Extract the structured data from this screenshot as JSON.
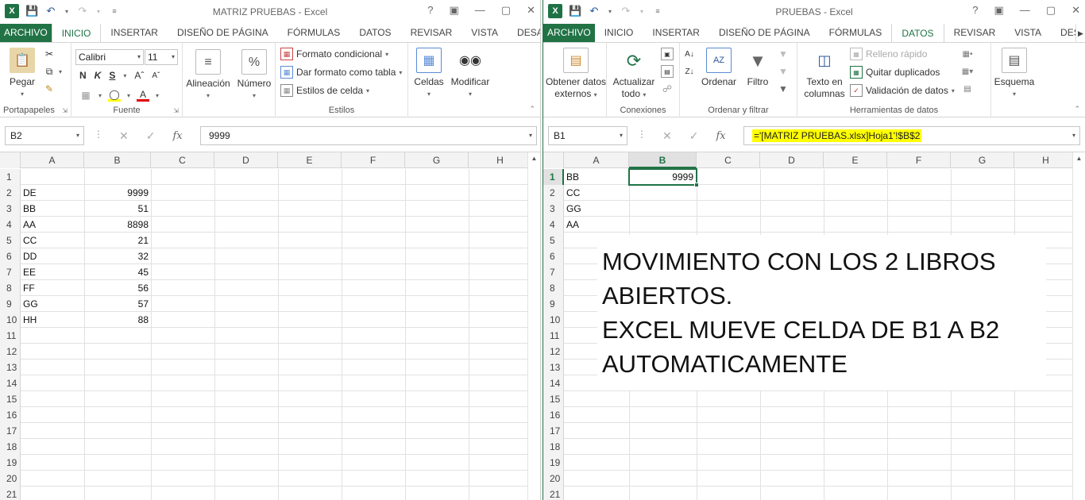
{
  "left_window": {
    "title": "MATRIZ PRUEBAS - Excel",
    "tabs": [
      "ARCHIVO",
      "INICIO",
      "INSERTAR",
      "DISEÑO DE PÁGINA",
      "FÓRMULAS",
      "DATOS",
      "REVISAR",
      "VISTA",
      "DESAR"
    ],
    "active_tab": "INICIO",
    "ribbon": {
      "paste_label": "Pegar",
      "clipboard_group": "Portapapeles",
      "font_name": "Calibri",
      "font_size": "11",
      "font_group": "Fuente",
      "bold": "N",
      "italic": "K",
      "underline": "S",
      "alignment_label": "Alineación",
      "number_label": "Número",
      "conditional_format": "Formato condicional",
      "format_as_table": "Dar formato como tabla",
      "cell_styles": "Estilos de celda",
      "styles_group": "Estilos",
      "cells_label": "Celdas",
      "modify_label": "Modificar"
    },
    "name_box": "B2",
    "formula": "9999",
    "columns": [
      "A",
      "B",
      "C",
      "D",
      "E",
      "F",
      "G",
      "H"
    ],
    "rows": [
      "1",
      "2",
      "3",
      "4",
      "5",
      "6",
      "7",
      "8",
      "9",
      "10",
      "11",
      "12",
      "13",
      "14",
      "15",
      "16",
      "17",
      "18",
      "19",
      "20",
      "21"
    ],
    "cells_a": [
      "",
      "DE",
      "BB",
      "AA",
      "CC",
      "DD",
      "EE",
      "FF",
      "GG",
      "HH"
    ],
    "cells_b": [
      "",
      "9999",
      "51",
      "8898",
      "21",
      "32",
      "45",
      "56",
      "57",
      "88"
    ]
  },
  "right_window": {
    "title": "PRUEBAS - Excel",
    "tabs": [
      "ARCHIVO",
      "INICIO",
      "INSERTAR",
      "DISEÑO DE PÁGINA",
      "FÓRMULAS",
      "DATOS",
      "REVISAR",
      "VISTA",
      "DESAR"
    ],
    "active_tab": "DATOS",
    "ribbon": {
      "get_external_1": "Obtener datos",
      "get_external_2": "externos",
      "refresh_1": "Actualizar",
      "refresh_2": "todo",
      "connections_group": "Conexiones",
      "sort_label": "Ordenar",
      "filter_label": "Filtro",
      "sort_filter_group": "Ordenar y filtrar",
      "text_to_columns_1": "Texto en",
      "text_to_columns_2": "columnas",
      "flash_fill": "Relleno rápido",
      "remove_duplicates": "Quitar duplicados",
      "data_validation": "Validación de datos",
      "data_tools_group": "Herramientas de datos",
      "outline_label": "Esquema"
    },
    "name_box": "B1",
    "formula": "='[MATRIZ PRUEBAS.xlsx]Hoja1'!$B$2",
    "columns": [
      "A",
      "B",
      "C",
      "D",
      "E",
      "F",
      "G",
      "H"
    ],
    "rows": [
      "1",
      "2",
      "3",
      "4",
      "5",
      "6",
      "7",
      "8",
      "9",
      "10",
      "11",
      "12",
      "13",
      "14",
      "15",
      "16",
      "17",
      "18",
      "19",
      "20",
      "21"
    ],
    "cells_a": [
      "BB",
      "CC",
      "GG",
      "AA"
    ],
    "cells_b": [
      "9999",
      "",
      "",
      ""
    ],
    "note_lines": [
      "MOVIMIENTO CON LOS 2 LIBROS",
      "ABIERTOS.",
      "EXCEL MUEVE CELDA DE B1 A B2",
      "AUTOMATICAMENTE"
    ]
  },
  "colors": {
    "excel_green": "#217346",
    "highlight": "#ffff00"
  }
}
